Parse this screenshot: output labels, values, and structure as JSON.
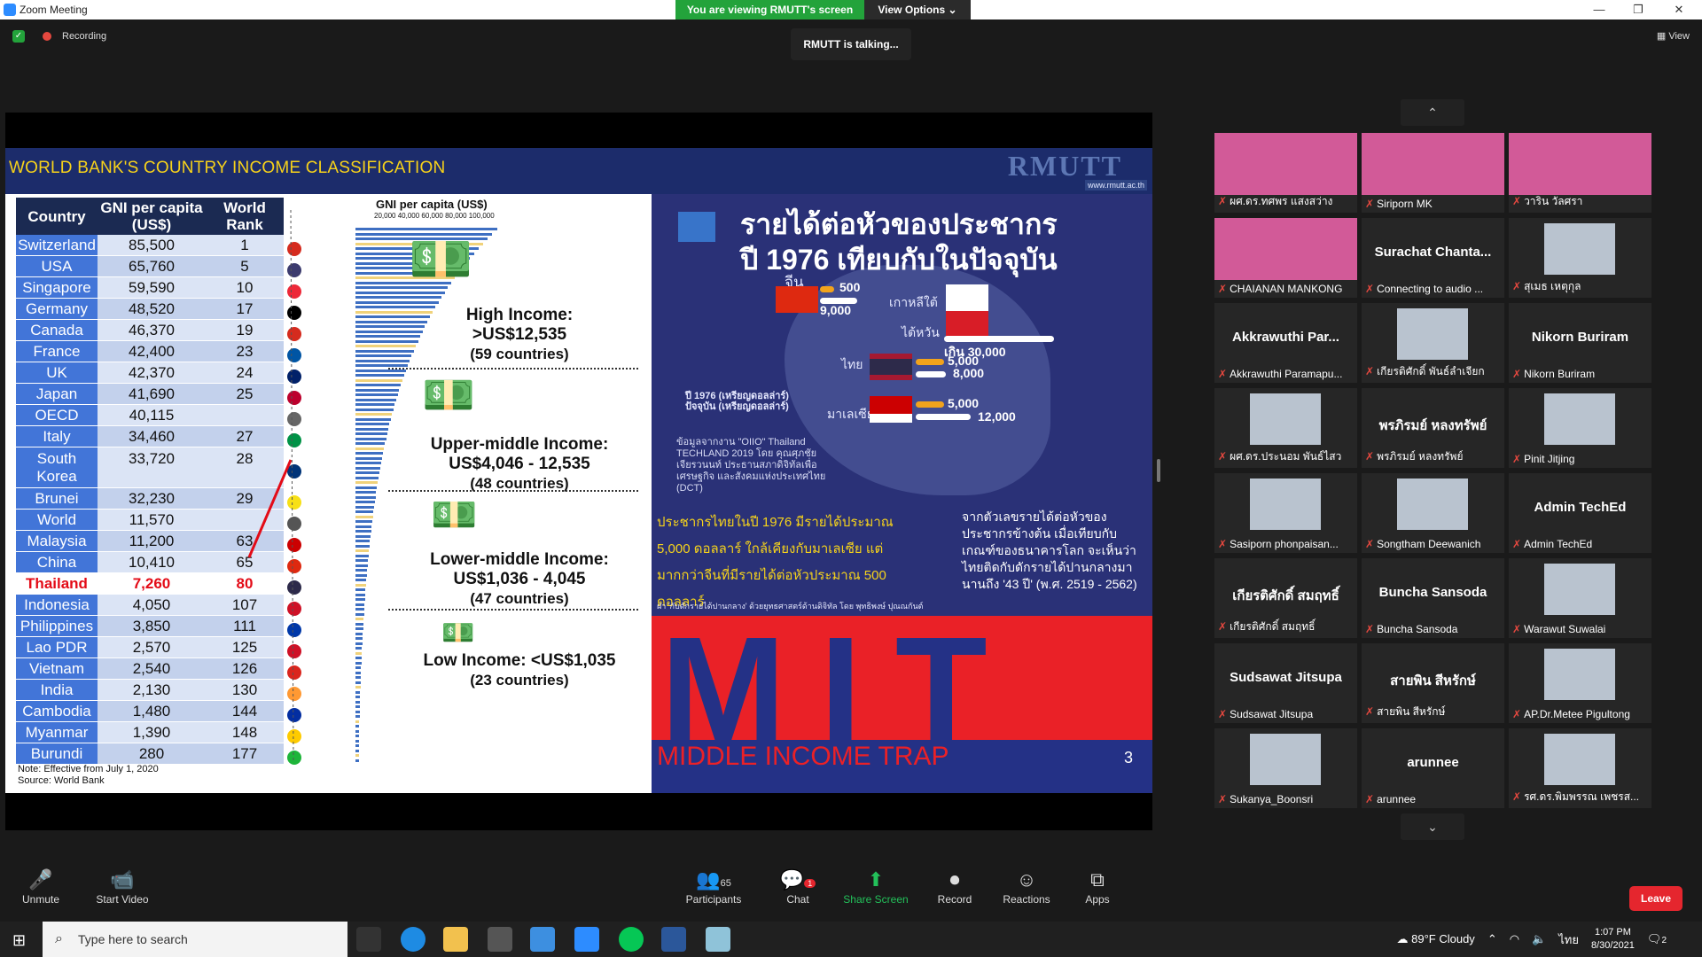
{
  "window": {
    "title": "Zoom Meeting",
    "viewing_banner": "You are viewing RMUTT's screen",
    "view_options": "View Options"
  },
  "top": {
    "recording": "Recording",
    "talking": "RMUTT is talking...",
    "view_label": "View"
  },
  "slide": {
    "title": "WORLD BANK'S COUNTRY INCOME CLASSIFICATION",
    "logo": "RMUTT",
    "url": "www.rmutt.ac.th",
    "table_headers": [
      "Country",
      "GNI per capita (US$)",
      "World Rank"
    ],
    "rows": [
      {
        "country": "Switzerland",
        "gni": "85,500",
        "rank": "1"
      },
      {
        "country": "USA",
        "gni": "65,760",
        "rank": "5"
      },
      {
        "country": "Singapore",
        "gni": "59,590",
        "rank": "10"
      },
      {
        "country": "Germany",
        "gni": "48,520",
        "rank": "17"
      },
      {
        "country": "Canada",
        "gni": "46,370",
        "rank": "19"
      },
      {
        "country": "France",
        "gni": "42,400",
        "rank": "23"
      },
      {
        "country": "UK",
        "gni": "42,370",
        "rank": "24"
      },
      {
        "country": "Japan",
        "gni": "41,690",
        "rank": "25"
      },
      {
        "country": "OECD",
        "gni": "40,115",
        "rank": ""
      },
      {
        "country": "Italy",
        "gni": "34,460",
        "rank": "27"
      },
      {
        "country": "South Korea",
        "gni": "33,720",
        "rank": "28"
      },
      {
        "country": "Brunei",
        "gni": "32,230",
        "rank": "29"
      },
      {
        "country": "World",
        "gni": "11,570",
        "rank": ""
      },
      {
        "country": "Malaysia",
        "gni": "11,200",
        "rank": "63"
      },
      {
        "country": "China",
        "gni": "10,410",
        "rank": "65"
      },
      {
        "country": "Thailand",
        "gni": "7,260",
        "rank": "80"
      },
      {
        "country": "Indonesia",
        "gni": "4,050",
        "rank": "107"
      },
      {
        "country": "Philippines",
        "gni": "3,850",
        "rank": "111"
      },
      {
        "country": "Lao PDR",
        "gni": "2,570",
        "rank": "125"
      },
      {
        "country": "Vietnam",
        "gni": "2,540",
        "rank": "126"
      },
      {
        "country": "India",
        "gni": "2,130",
        "rank": "130"
      },
      {
        "country": "Cambodia",
        "gni": "1,480",
        "rank": "144"
      },
      {
        "country": "Myanmar",
        "gni": "1,390",
        "rank": "148"
      },
      {
        "country": "Burundi",
        "gni": "280",
        "rank": "177"
      }
    ],
    "gni_header": "GNI per capita (US$)",
    "gni_scale": "20,000 40,000 60,000 80,000 100,000",
    "high": {
      "t1": "High Income:",
      "t2": ">US$12,535",
      "t3": "(59 countries)"
    },
    "upper": {
      "t1": "Upper-middle Income:",
      "t2": "US$4,046 - 12,535",
      "t3": "(48 countries)"
    },
    "lower": {
      "t1": "Lower-middle Income:",
      "t2": "US$1,036 - 4,045",
      "t3": "(47 countries)"
    },
    "low": {
      "t1": "Low Income: <US$1,035",
      "t3": "(23 countries)"
    },
    "note": "Note: Effective from July 1, 2020",
    "source": "Source: World Bank",
    "thai_title_1": "รายได้ต่อหัวของประชากร",
    "thai_title_2": "ปี 1976 เทียบกับในปัจจุบัน",
    "china_label": "จีน",
    "korea_label": "เกาหลีใต้",
    "taiwan_label": "ไต้หวัน",
    "thai_label": "ไทย",
    "malaysia_label": "มาเลเซีย",
    "china_1976": "500",
    "china_now": "9,000",
    "korea_now": "เกิน 30,000",
    "thai_1976": "5,000",
    "thai_now": "8,000",
    "malaysia_1976": "5,000",
    "malaysia_now": "12,000",
    "legend_1976": "ปี 1976 (เหรียญดอลล่าร์)",
    "legend_now": "ปัจจุบัน (เหรียญดอลล่าร์)",
    "source_thai": "ข้อมูลจากงาน \"OIIO\" Thailand TECHLAND 2019 โดย คุณศุภชัย เจียรวนนท์ ประธานสภาดิจิทัลเพื่อเศรษฐกิจ และสังคมแห่งประเทศไทย (DCT)",
    "yellow_line1": "ประชากรไทยในปี 1976 มีรายได้ประมาณ",
    "yellow_line2": "5,000 ดอลลาร์ ใกล้เคียงกับมาเลเซีย แต่",
    "yellow_line3": "มากกว่าจีนที่มีรายได้ต่อหัวประมาณ 500 ดอลลาร์",
    "white_text": "จากตัวเลขรายได้ต่อหัวของประชากรข้างต้น เมื่อเทียบกับเกณฑ์ของธนาคารโลก จะเห็นว่าไทยติดกับดักรายได้ปานกลางมานานถึง '43 ปี' (พ.ศ. 2519 - 2562)",
    "footnote": "ฝ่า 'กับดักรายได้ปานกลาง' ด้วยยุทธศาสตร์ด้านดิจิทัล โดย พุทธิพงษ์ ปุณณกันต์",
    "mit": "MIT",
    "mit_caption": "MIDDLE INCOME TRAP",
    "page": "3"
  },
  "participants": [
    {
      "name": "",
      "sub": "ผศ.ดร.ทศพร แสงสว่าง",
      "video": "pink"
    },
    {
      "name": "",
      "sub": "Siriporn MK",
      "video": "pink"
    },
    {
      "name": "",
      "sub": "วาริน วัลศรา",
      "video": "pink"
    },
    {
      "name": "",
      "sub": "CHAIANAN MANKONG",
      "video": "pink"
    },
    {
      "name": "Surachat Chanta...",
      "sub": "Connecting to audio ...",
      "video": ""
    },
    {
      "name": "",
      "sub": "สุเมธ เหตุกุล",
      "video": "face"
    },
    {
      "name": "Akkrawuthi Par...",
      "sub": "Akkrawuthi Paramapu...",
      "video": ""
    },
    {
      "name": "",
      "sub": "เกียรติศักดิ์ พันธ์ลำเจียก",
      "video": "face"
    },
    {
      "name": "Nikorn Buriram",
      "sub": "Nikorn Buriram",
      "video": ""
    },
    {
      "name": "",
      "sub": "ผศ.ดร.ประนอม พันธ์ไสว",
      "video": "face"
    },
    {
      "name": "พรภิรมย์ หลงทรัพย์",
      "sub": "พรภิรมย์ หลงทรัพย์",
      "video": ""
    },
    {
      "name": "",
      "sub": "Pinit Jitjing",
      "video": "face"
    },
    {
      "name": "",
      "sub": "Sasiporn phonpaisan...",
      "video": "face"
    },
    {
      "name": "",
      "sub": "Songtham Deewanich",
      "video": "face"
    },
    {
      "name": "Admin TechEd",
      "sub": "Admin TechEd",
      "video": ""
    },
    {
      "name": "เกียรติศักดิ์ สมฤทธิ์",
      "sub": "เกียรติศักดิ์ สมฤทธิ์",
      "video": ""
    },
    {
      "name": "Buncha Sansoda",
      "sub": "Buncha Sansoda",
      "video": ""
    },
    {
      "name": "",
      "sub": "Warawut Suwalai",
      "video": "face"
    },
    {
      "name": "Sudsawat Jitsupa",
      "sub": "Sudsawat Jitsupa",
      "video": ""
    },
    {
      "name": "สายพิน สีหรักษ์",
      "sub": "สายพิน สีหรักษ์",
      "video": ""
    },
    {
      "name": "",
      "sub": "AP.Dr.Metee Pigultong",
      "video": "face"
    },
    {
      "name": "",
      "sub": "Sukanya_Boonsri",
      "video": "face"
    },
    {
      "name": "arunnee",
      "sub": "arunnee",
      "video": ""
    },
    {
      "name": "",
      "sub": "รศ.ดร.พิมพรรณ เพชรส...",
      "video": "face"
    }
  ],
  "toolbar": {
    "unmute": "Unmute",
    "start_video": "Start Video",
    "participants": "Participants",
    "participants_count": "65",
    "chat": "Chat",
    "chat_badge": "1",
    "share": "Share Screen",
    "record": "Record",
    "reactions": "Reactions",
    "apps": "Apps",
    "leave": "Leave"
  },
  "taskbar": {
    "search_placeholder": "Type here to search",
    "weather": "89°F  Cloudy",
    "lang": "ไทย",
    "time": "1:07 PM",
    "date": "8/30/2021",
    "notif": "2"
  }
}
